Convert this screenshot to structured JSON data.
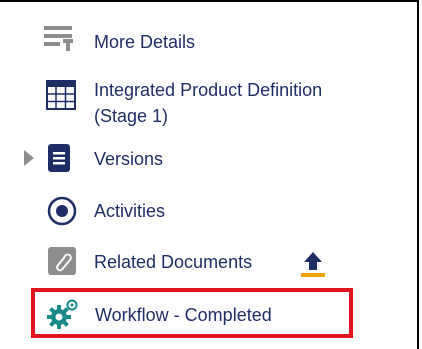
{
  "menu": {
    "items": [
      {
        "label": "More Details",
        "icon": "list-details-icon"
      },
      {
        "label": "Integrated Product Definition",
        "label_line2": "(Stage 1)",
        "icon": "table-grid-icon"
      },
      {
        "label": "Versions",
        "icon": "document-versions-icon",
        "expandable": true
      },
      {
        "label": "Activities",
        "icon": "radio-circle-icon"
      },
      {
        "label": "Related Documents",
        "icon": "attachment-icon",
        "action_icon": "upload-icon"
      },
      {
        "label": "Workflow - Completed",
        "icon": "gears-icon",
        "highlighted": true
      }
    ]
  },
  "colors": {
    "label": "#1f2d67",
    "icon_blue": "#1f2d67",
    "icon_gray": "#8d8d8d",
    "icon_teal": "#1a8a8a",
    "upload_orange": "#f0a500",
    "highlight": "#e0141a"
  }
}
